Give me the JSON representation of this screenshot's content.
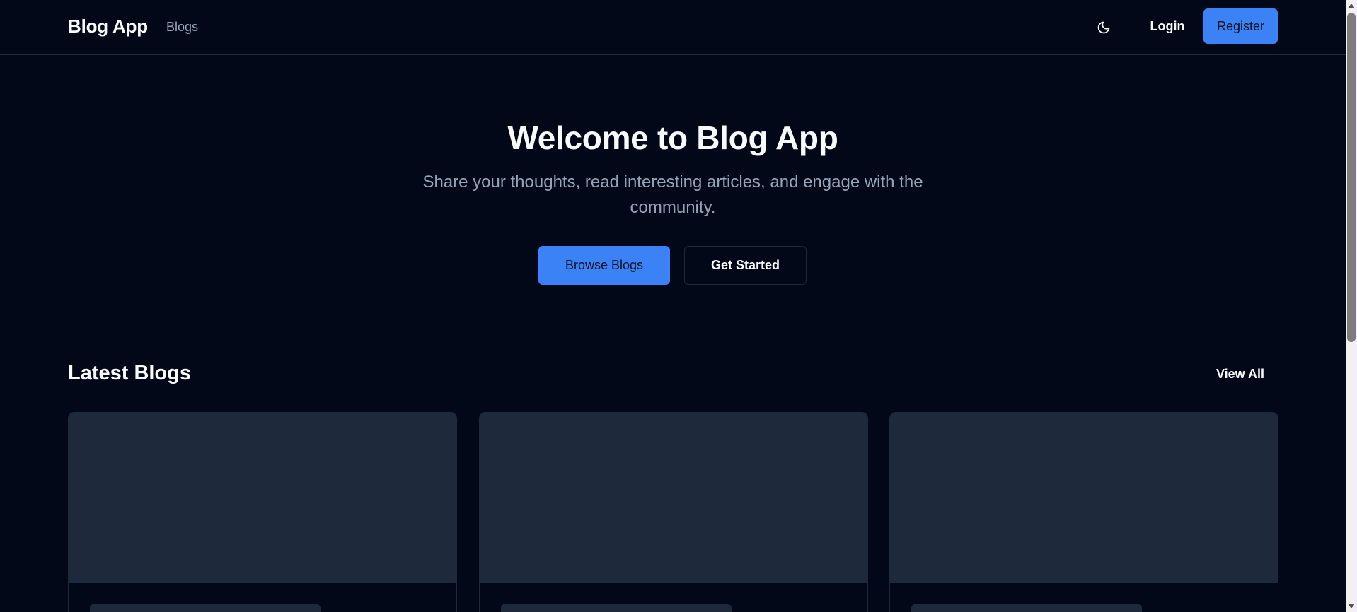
{
  "header": {
    "brand": "Blog App",
    "nav": [
      {
        "label": "Blogs"
      }
    ],
    "theme_toggle_icon": "moon-icon",
    "login_label": "Login",
    "register_label": "Register"
  },
  "hero": {
    "title": "Welcome to Blog App",
    "subtitle": "Share your thoughts, read interesting articles, and engage with the community.",
    "primary_cta": "Browse Blogs",
    "secondary_cta": "Get Started"
  },
  "latest": {
    "title": "Latest Blogs",
    "view_all_label": "View All",
    "card_count_visible": 3
  },
  "colors": {
    "background": "#020817",
    "accent": "#3b82f6",
    "muted_text": "#94a3b8",
    "border": "#1e293b",
    "skeleton": "#1e293b"
  }
}
